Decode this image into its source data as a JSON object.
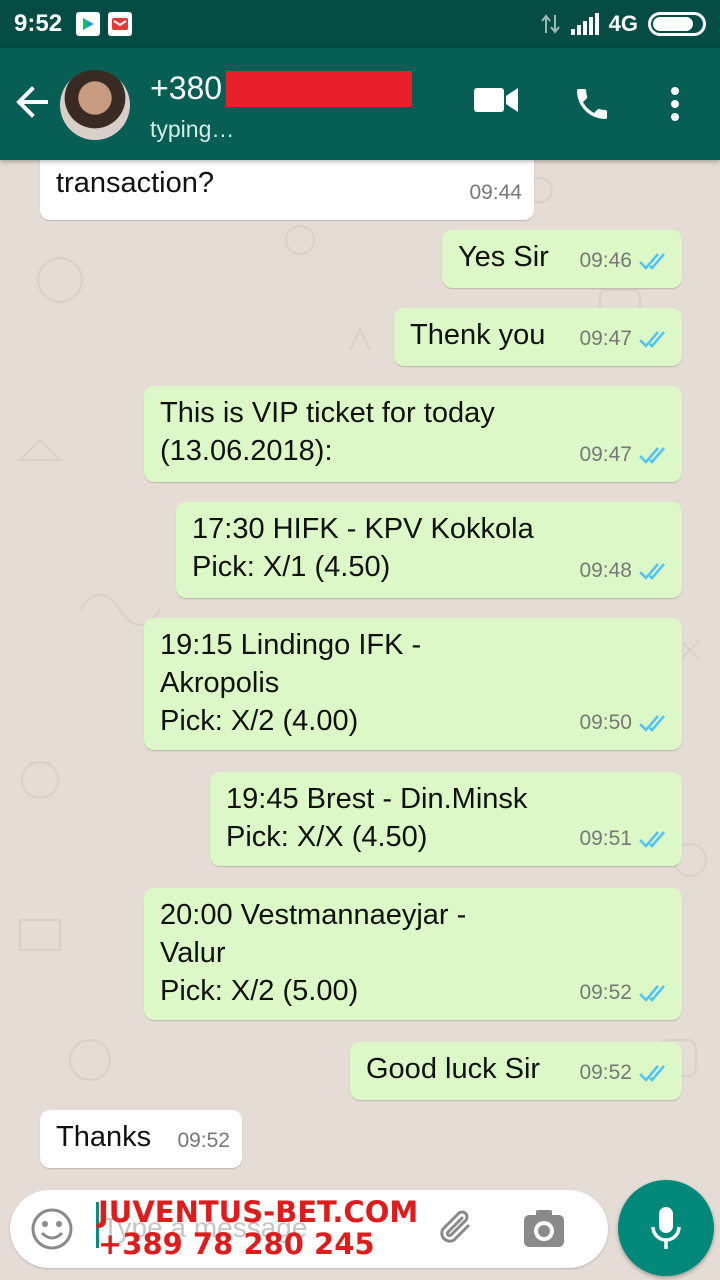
{
  "status_bar": {
    "time": "9:52",
    "network": "4G"
  },
  "header": {
    "contact": "+380",
    "status": "typing…"
  },
  "messages": [
    {
      "dir": "in",
      "text": "Did you receive the\ntransaction?",
      "time": "09:44"
    },
    {
      "dir": "out",
      "text": "Yes Sir",
      "time": "09:46"
    },
    {
      "dir": "out",
      "text": "Thenk you",
      "time": "09:47"
    },
    {
      "dir": "out",
      "text": "This is VIP ticket for today\n(13.06.2018):",
      "time": "09:47"
    },
    {
      "dir": "out",
      "text": "17:30 HIFK - KPV Kokkola\nPick: X/1 (4.50)",
      "time": "09:48"
    },
    {
      "dir": "out",
      "text": "19:15 Lindingo IFK -\nAkropolis\nPick: X/2 (4.00)",
      "time": "09:50"
    },
    {
      "dir": "out",
      "text": "19:45 Brest - Din.Minsk\nPick: X/X (4.50)",
      "time": "09:51"
    },
    {
      "dir": "out",
      "text": "20:00 Vestmannaeyjar -\nValur\nPick: X/2 (5.00)",
      "time": "09:52"
    },
    {
      "dir": "out",
      "text": "Good luck Sir",
      "time": "09:52"
    },
    {
      "dir": "in",
      "text": "Thanks",
      "time": "09:52"
    }
  ],
  "input": {
    "placeholder": "Type a message"
  },
  "watermark": {
    "line1": "JUVENTUS-BET.COM",
    "line2": "+389 78 280 245"
  },
  "colors": {
    "header": "#075e54",
    "status_bar": "#054d44",
    "outgoing": "#dcf8c6",
    "incoming": "#ffffff",
    "tick_read": "#4fc3f7",
    "accent": "#00897b",
    "redaction": "#e8202c"
  },
  "icons": [
    "back-arrow-icon",
    "video-call-icon",
    "phone-icon",
    "more-vertical-icon",
    "emoji-icon",
    "attach-icon",
    "camera-icon",
    "mic-icon",
    "double-tick-icon"
  ]
}
